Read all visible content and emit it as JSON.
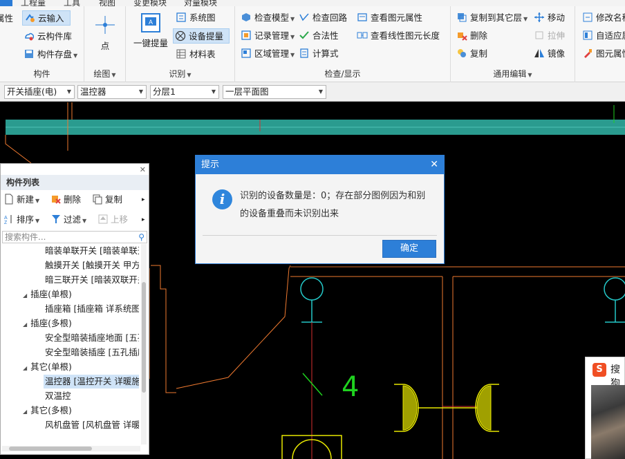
{
  "menubar": {
    "tabs": [
      "工程量",
      "工具",
      "视图",
      "变更模块",
      "对量模块"
    ]
  },
  "ribbon": {
    "groups": {
      "component": {
        "title": "构件",
        "items": [
          "属性",
          "云输入",
          "云构件库",
          "构件存盘"
        ]
      },
      "draw": {
        "title": "绘图",
        "point_label": "点"
      },
      "identify": {
        "title": "识别",
        "one_key_label": "一键提量",
        "items": [
          "系统图",
          "设备提量",
          "材料表"
        ]
      },
      "check": {
        "title": "检查/显示",
        "items": [
          "检查模型",
          "检查回路",
          "查看图元属性",
          "记录管理",
          "合法性",
          "查看线性图元长度",
          "区域管理",
          "计算式"
        ]
      },
      "edit": {
        "title": "通用编辑",
        "items": [
          "复制到其它层",
          "移动",
          "删除",
          "拉伸",
          "复制",
          "镜像"
        ]
      },
      "extra": {
        "items": [
          "修改名称",
          "自适应属性",
          "图元属性"
        ]
      }
    }
  },
  "selectors": {
    "discipline": "开关插座(电)",
    "component_type": "温控器",
    "layer": "分层1",
    "floor": "一层平面图"
  },
  "panel": {
    "title": "构件列表",
    "tools": {
      "new": "新建",
      "delete": "删除",
      "copy": "复制",
      "sort": "排序",
      "filter": "过滤",
      "up": "上移"
    },
    "search_placeholder": "搜索构件...",
    "tree": [
      {
        "label": "暗装单联开关 [暗装单联开",
        "level": 2
      },
      {
        "label": "触摸开关 [触摸开关 甲方",
        "level": 2
      },
      {
        "label": "暗三联开关 [暗装双联开关",
        "level": 2
      },
      {
        "label": "插座(单根)",
        "level": 1
      },
      {
        "label": "插座箱 [插座箱 详系统图]",
        "level": 2
      },
      {
        "label": "插座(多根)",
        "level": 1
      },
      {
        "label": "安全型暗装插座地面 [五孔",
        "level": 2
      },
      {
        "label": "安全型暗装插座 [五孔插座",
        "level": 2
      },
      {
        "label": "其它(单根)",
        "level": 1
      },
      {
        "label": "温控器 [温控开关 详暖施]",
        "level": 2,
        "selected": true
      },
      {
        "label": "双温控",
        "level": 2
      },
      {
        "label": "其它(多根)",
        "level": 1
      },
      {
        "label": "风机盘管 [风机盘管 详暖",
        "level": 2
      }
    ]
  },
  "dialog": {
    "title": "提示",
    "message": "识别的设备数量是：0；存在部分图例因为和别的设备重叠而未识别出来",
    "ok_label": "确定"
  },
  "canvas": {
    "annotation": "4"
  },
  "ime": {
    "label": "搜狗"
  },
  "colors": {
    "accent": "#2d7fd8",
    "canvas_bg": "#000000",
    "wall": "#f07a30",
    "beam": "#2a9b8f",
    "symbol_cyan": "#24c8c8",
    "symbol_yellow": "#e8e800",
    "wire_red": "#d83030"
  }
}
